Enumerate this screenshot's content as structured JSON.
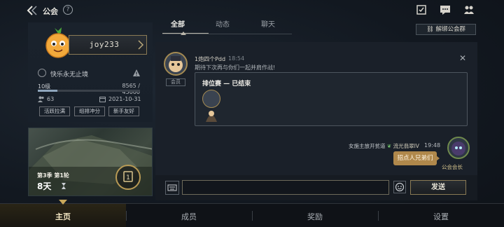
{
  "header": {
    "title": "公会",
    "help_label": "?"
  },
  "profile": {
    "name": "joy233",
    "motto": "快乐永无止境",
    "level": "10级",
    "xp": "8565 / 45000",
    "xp_progress": 0.19,
    "member_count": "63",
    "created_date": "2021-10-31",
    "tags": [
      "活跃拉满",
      "组排冲分",
      "新手友好"
    ]
  },
  "season": {
    "label": "第3季 第1轮",
    "days": "8天",
    "badge": "1"
  },
  "tabs": {
    "all": "全部",
    "activity": "动态",
    "chat": "聊天"
  },
  "unbind_button": "解绑公会群",
  "messages": {
    "left": {
      "name": "1炮四个Pdd",
      "time": "18:54",
      "text": "期待下次再与你们一起并肩作战!",
      "role": "会员",
      "card_title": "排位赛 — 已结束"
    },
    "right": {
      "name": "女施主放开贫道",
      "rank": "流光翡翠IV",
      "time": "19:48",
      "text": "招点人兄弟们",
      "role": "公会会长"
    }
  },
  "input": {
    "placeholder": "",
    "send_label": "发送"
  },
  "nav": {
    "home": "主页",
    "members": "成员",
    "rewards": "奖励",
    "settings": "设置"
  },
  "colors": {
    "accent_gold": "#b0884b",
    "bg": "#141a22"
  }
}
